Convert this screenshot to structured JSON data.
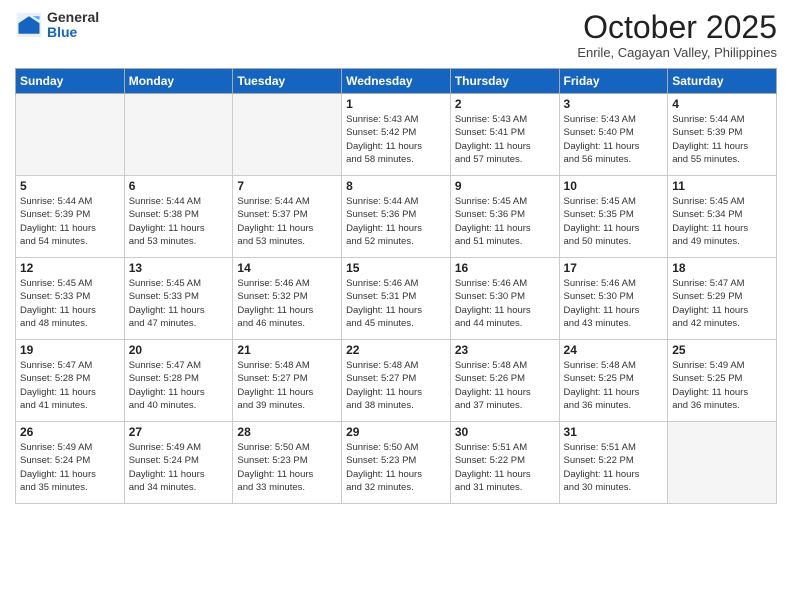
{
  "header": {
    "logo_general": "General",
    "logo_blue": "Blue",
    "month": "October 2025",
    "location": "Enrile, Cagayan Valley, Philippines"
  },
  "weekdays": [
    "Sunday",
    "Monday",
    "Tuesday",
    "Wednesday",
    "Thursday",
    "Friday",
    "Saturday"
  ],
  "weeks": [
    [
      {
        "day": "",
        "info": ""
      },
      {
        "day": "",
        "info": ""
      },
      {
        "day": "",
        "info": ""
      },
      {
        "day": "1",
        "info": "Sunrise: 5:43 AM\nSunset: 5:42 PM\nDaylight: 11 hours\nand 58 minutes."
      },
      {
        "day": "2",
        "info": "Sunrise: 5:43 AM\nSunset: 5:41 PM\nDaylight: 11 hours\nand 57 minutes."
      },
      {
        "day": "3",
        "info": "Sunrise: 5:43 AM\nSunset: 5:40 PM\nDaylight: 11 hours\nand 56 minutes."
      },
      {
        "day": "4",
        "info": "Sunrise: 5:44 AM\nSunset: 5:39 PM\nDaylight: 11 hours\nand 55 minutes."
      }
    ],
    [
      {
        "day": "5",
        "info": "Sunrise: 5:44 AM\nSunset: 5:39 PM\nDaylight: 11 hours\nand 54 minutes."
      },
      {
        "day": "6",
        "info": "Sunrise: 5:44 AM\nSunset: 5:38 PM\nDaylight: 11 hours\nand 53 minutes."
      },
      {
        "day": "7",
        "info": "Sunrise: 5:44 AM\nSunset: 5:37 PM\nDaylight: 11 hours\nand 53 minutes."
      },
      {
        "day": "8",
        "info": "Sunrise: 5:44 AM\nSunset: 5:36 PM\nDaylight: 11 hours\nand 52 minutes."
      },
      {
        "day": "9",
        "info": "Sunrise: 5:45 AM\nSunset: 5:36 PM\nDaylight: 11 hours\nand 51 minutes."
      },
      {
        "day": "10",
        "info": "Sunrise: 5:45 AM\nSunset: 5:35 PM\nDaylight: 11 hours\nand 50 minutes."
      },
      {
        "day": "11",
        "info": "Sunrise: 5:45 AM\nSunset: 5:34 PM\nDaylight: 11 hours\nand 49 minutes."
      }
    ],
    [
      {
        "day": "12",
        "info": "Sunrise: 5:45 AM\nSunset: 5:33 PM\nDaylight: 11 hours\nand 48 minutes."
      },
      {
        "day": "13",
        "info": "Sunrise: 5:45 AM\nSunset: 5:33 PM\nDaylight: 11 hours\nand 47 minutes."
      },
      {
        "day": "14",
        "info": "Sunrise: 5:46 AM\nSunset: 5:32 PM\nDaylight: 11 hours\nand 46 minutes."
      },
      {
        "day": "15",
        "info": "Sunrise: 5:46 AM\nSunset: 5:31 PM\nDaylight: 11 hours\nand 45 minutes."
      },
      {
        "day": "16",
        "info": "Sunrise: 5:46 AM\nSunset: 5:30 PM\nDaylight: 11 hours\nand 44 minutes."
      },
      {
        "day": "17",
        "info": "Sunrise: 5:46 AM\nSunset: 5:30 PM\nDaylight: 11 hours\nand 43 minutes."
      },
      {
        "day": "18",
        "info": "Sunrise: 5:47 AM\nSunset: 5:29 PM\nDaylight: 11 hours\nand 42 minutes."
      }
    ],
    [
      {
        "day": "19",
        "info": "Sunrise: 5:47 AM\nSunset: 5:28 PM\nDaylight: 11 hours\nand 41 minutes."
      },
      {
        "day": "20",
        "info": "Sunrise: 5:47 AM\nSunset: 5:28 PM\nDaylight: 11 hours\nand 40 minutes."
      },
      {
        "day": "21",
        "info": "Sunrise: 5:48 AM\nSunset: 5:27 PM\nDaylight: 11 hours\nand 39 minutes."
      },
      {
        "day": "22",
        "info": "Sunrise: 5:48 AM\nSunset: 5:27 PM\nDaylight: 11 hours\nand 38 minutes."
      },
      {
        "day": "23",
        "info": "Sunrise: 5:48 AM\nSunset: 5:26 PM\nDaylight: 11 hours\nand 37 minutes."
      },
      {
        "day": "24",
        "info": "Sunrise: 5:48 AM\nSunset: 5:25 PM\nDaylight: 11 hours\nand 36 minutes."
      },
      {
        "day": "25",
        "info": "Sunrise: 5:49 AM\nSunset: 5:25 PM\nDaylight: 11 hours\nand 36 minutes."
      }
    ],
    [
      {
        "day": "26",
        "info": "Sunrise: 5:49 AM\nSunset: 5:24 PM\nDaylight: 11 hours\nand 35 minutes."
      },
      {
        "day": "27",
        "info": "Sunrise: 5:49 AM\nSunset: 5:24 PM\nDaylight: 11 hours\nand 34 minutes."
      },
      {
        "day": "28",
        "info": "Sunrise: 5:50 AM\nSunset: 5:23 PM\nDaylight: 11 hours\nand 33 minutes."
      },
      {
        "day": "29",
        "info": "Sunrise: 5:50 AM\nSunset: 5:23 PM\nDaylight: 11 hours\nand 32 minutes."
      },
      {
        "day": "30",
        "info": "Sunrise: 5:51 AM\nSunset: 5:22 PM\nDaylight: 11 hours\nand 31 minutes."
      },
      {
        "day": "31",
        "info": "Sunrise: 5:51 AM\nSunset: 5:22 PM\nDaylight: 11 hours\nand 30 minutes."
      },
      {
        "day": "",
        "info": ""
      }
    ]
  ]
}
